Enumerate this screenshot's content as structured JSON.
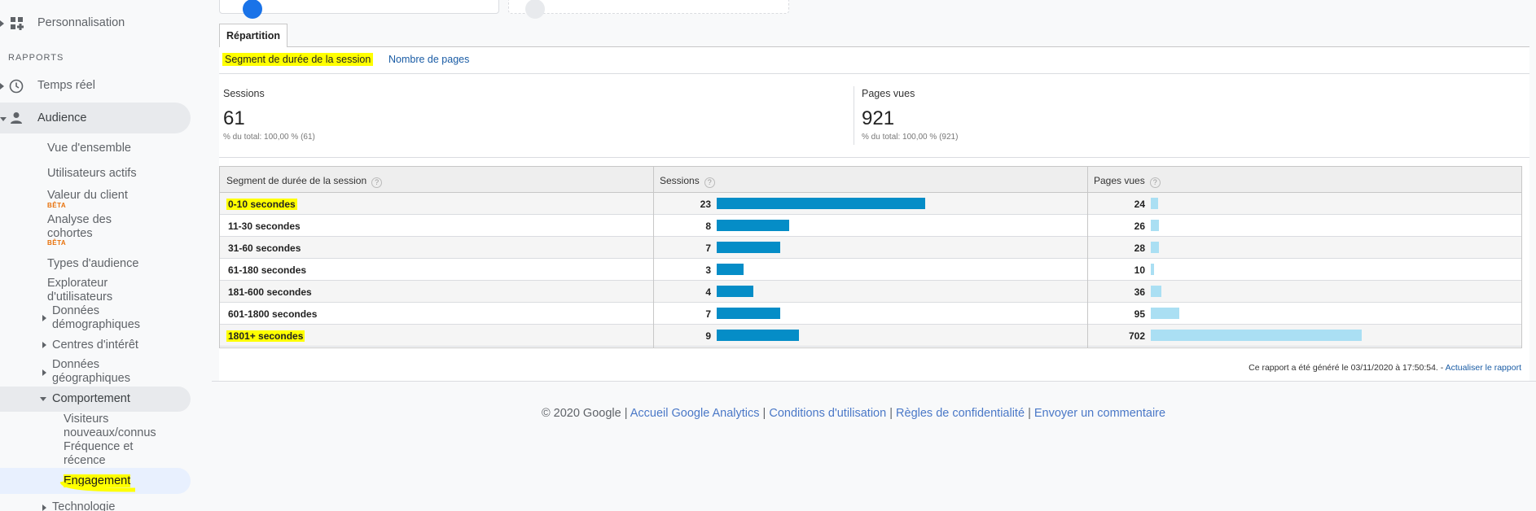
{
  "sidebar": {
    "customization": "Personnalisation",
    "section_reports": "RAPPORTS",
    "realtime": "Temps réel",
    "audience": "Audience",
    "overview": "Vue d'ensemble",
    "active_users": "Utilisateurs actifs",
    "lifetime_value": "Valeur du client",
    "lifetime_value_badge": "BÊTA",
    "cohort_line1": "Analyse des",
    "cohort_line2": "cohortes",
    "cohort_badge": "BÊTA",
    "audiences": "Types d'audience",
    "explorer_line1": "Explorateur",
    "explorer_line2": "d'utilisateurs",
    "demographics_line1": "Données",
    "demographics_line2": "démographiques",
    "interests": "Centres d'intérêt",
    "geo_line1": "Données",
    "geo_line2": "géographiques",
    "behavior": "Comportement",
    "new_returning_line1": "Visiteurs",
    "new_returning_line2": "nouveaux/connus",
    "frequency_line1": "Fréquence et",
    "frequency_line2": "récence",
    "engagement": "Engagement",
    "technology_partial": "Technologie"
  },
  "tab": {
    "label": "Répartition"
  },
  "segment_nav": {
    "active": "Segment de durée de la session",
    "other": "Nombre de pages"
  },
  "metrics": [
    {
      "label": "Sessions",
      "value": "61",
      "sub": "% du total: 100,00 % (61)"
    },
    {
      "label": "Pages vues",
      "value": "921",
      "sub": "% du total: 100,00 % (921)"
    }
  ],
  "table": {
    "headers": [
      "Segment de durée de la session",
      "Sessions",
      "Pages vues"
    ],
    "help_glyph": "?",
    "rows": [
      {
        "segment": "0-10 secondes",
        "sessions": "23",
        "sessions_share": 0.377,
        "pageviews": "24",
        "pageviews_share": 0.026,
        "highlight": true
      },
      {
        "segment": "11-30 secondes",
        "sessions": "8",
        "sessions_share": 0.131,
        "pageviews": "26",
        "pageviews_share": 0.028,
        "highlight": false
      },
      {
        "segment": "31-60 secondes",
        "sessions": "7",
        "sessions_share": 0.115,
        "pageviews": "28",
        "pageviews_share": 0.03,
        "highlight": false
      },
      {
        "segment": "61-180 secondes",
        "sessions": "3",
        "sessions_share": 0.049,
        "pageviews": "10",
        "pageviews_share": 0.011,
        "highlight": false
      },
      {
        "segment": "181-600 secondes",
        "sessions": "4",
        "sessions_share": 0.066,
        "pageviews": "36",
        "pageviews_share": 0.039,
        "highlight": false
      },
      {
        "segment": "601-1800 secondes",
        "sessions": "7",
        "sessions_share": 0.115,
        "pageviews": "95",
        "pageviews_share": 0.103,
        "highlight": false
      },
      {
        "segment": "1801+ secondes",
        "sessions": "9",
        "sessions_share": 0.148,
        "pageviews": "702",
        "pageviews_share": 0.762,
        "highlight": true
      }
    ]
  },
  "generated": {
    "text": "Ce rapport a été généré le 03/11/2020 à 17:50:54. -",
    "refresh": "Actualiser le rapport"
  },
  "footer": {
    "copyright": "© 2020 Google |",
    "links": [
      "Accueil Google Analytics",
      "Conditions d'utilisation",
      "Règles de confidentialité",
      "Envoyer un commentaire"
    ],
    "separator": "|"
  },
  "colors": {
    "sessions_bar": "#058dc7",
    "pageviews_bar": "#aadff3",
    "highlight": "#ffff00",
    "link": "#1a5ca5"
  }
}
